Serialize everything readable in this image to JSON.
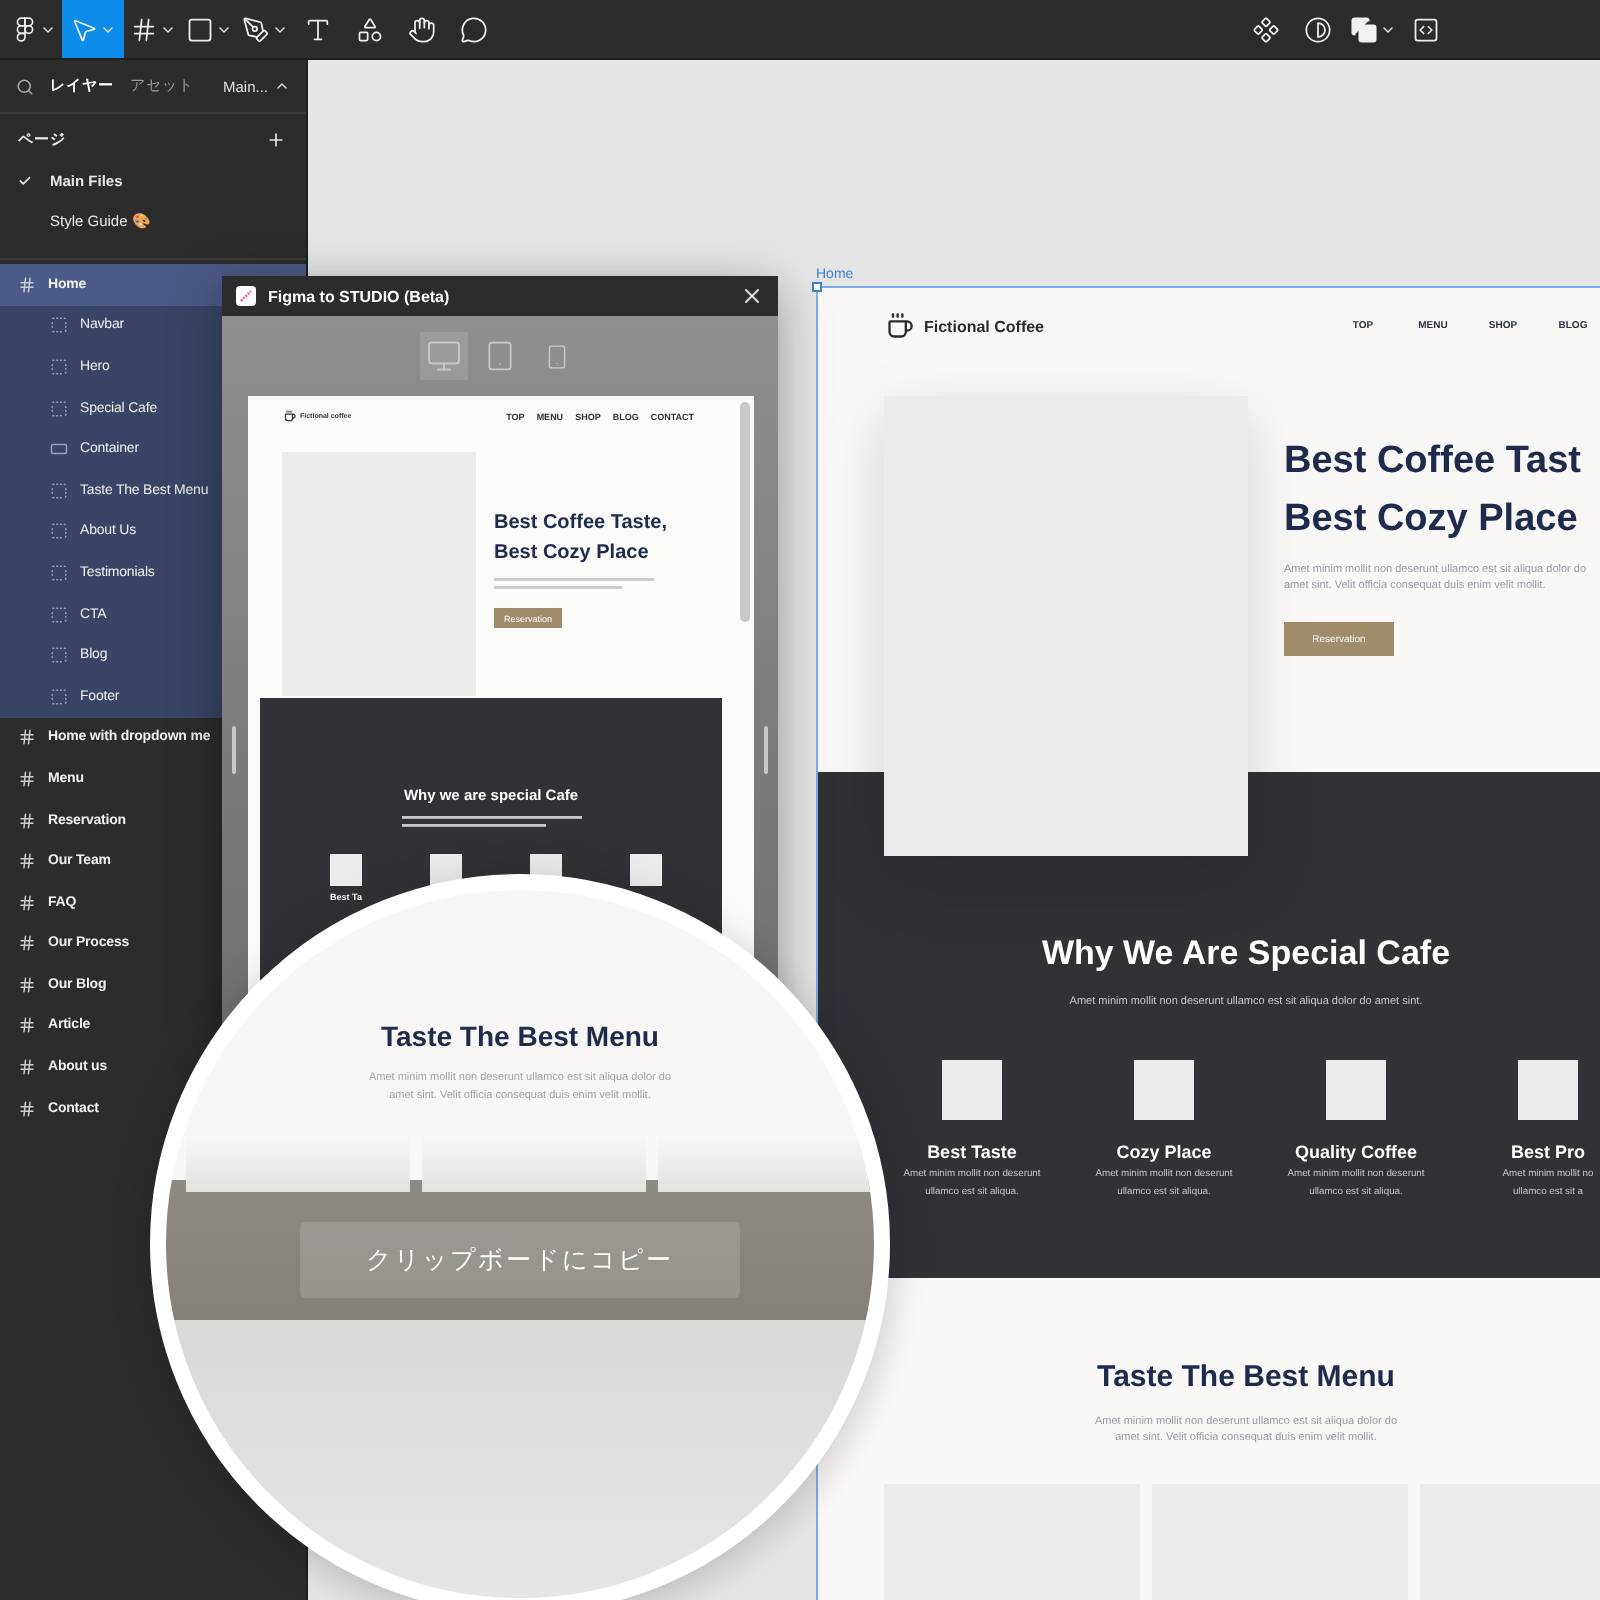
{
  "toolbar": {
    "tools": [
      {
        "kind": "main",
        "caret": true,
        "selected": false
      },
      {
        "kind": "move",
        "caret": true,
        "selected": true
      },
      {
        "kind": "frame",
        "caret": true,
        "selected": false
      },
      {
        "kind": "shape",
        "caret": true,
        "selected": false
      },
      {
        "kind": "pen",
        "caret": true,
        "selected": false
      },
      {
        "kind": "text",
        "caret": false,
        "selected": false
      },
      {
        "kind": "resources",
        "caret": false,
        "selected": false
      },
      {
        "kind": "hand",
        "caret": false,
        "selected": false
      },
      {
        "kind": "comment",
        "caret": false,
        "selected": false
      }
    ],
    "right_tools": [
      {
        "kind": "component",
        "caret": false
      },
      {
        "kind": "theme",
        "caret": false
      },
      {
        "kind": "boolean",
        "caret": true
      },
      {
        "kind": "dev",
        "caret": false
      }
    ]
  },
  "sidebar": {
    "tabs": [
      {
        "label": "レイヤー",
        "selected": true
      },
      {
        "label": "アセット",
        "selected": false
      }
    ],
    "page_menu": "Main...",
    "pages_title": "ページ",
    "pages": [
      {
        "label": "Main Files",
        "selected": true
      },
      {
        "label": "Style Guide 🎨",
        "selected": false
      }
    ],
    "layers": [
      {
        "label": "Home",
        "kind": "frame",
        "selected": true,
        "children": [
          {
            "label": "Navbar",
            "kind": "section",
            "selected": false
          },
          {
            "label": "Hero",
            "kind": "section",
            "selected": false
          },
          {
            "label": "Special Cafe",
            "kind": "section",
            "selected": false
          },
          {
            "label": "Container",
            "kind": "container",
            "selected": false
          },
          {
            "label": "Taste The Best Menu",
            "kind": "section",
            "selected": false
          },
          {
            "label": "About Us",
            "kind": "section",
            "selected": false
          },
          {
            "label": "Testimonials",
            "kind": "section",
            "selected": false
          },
          {
            "label": "CTA",
            "kind": "section",
            "selected": false
          },
          {
            "label": "Blog",
            "kind": "section",
            "selected": false
          },
          {
            "label": "Footer",
            "kind": "section",
            "selected": false
          }
        ]
      },
      {
        "label": "Home with dropdown me",
        "kind": "frame",
        "selected": false
      },
      {
        "label": "Menu",
        "kind": "frame",
        "selected": false
      },
      {
        "label": "Reservation",
        "kind": "frame",
        "selected": false
      },
      {
        "label": "Our Team",
        "kind": "frame",
        "selected": false
      },
      {
        "label": "FAQ",
        "kind": "frame",
        "selected": false
      },
      {
        "label": "Our Process",
        "kind": "frame",
        "selected": false
      },
      {
        "label": "Our Blog",
        "kind": "frame",
        "selected": false
      },
      {
        "label": "Article",
        "kind": "frame",
        "selected": false
      },
      {
        "label": "About us",
        "kind": "frame",
        "selected": false
      },
      {
        "label": "Contact",
        "kind": "frame",
        "selected": false
      }
    ]
  },
  "canvas": {
    "frame_label": "Home",
    "site": {
      "brand": "Fictional Coffee",
      "nav": [
        "TOP",
        "MENU",
        "SHOP",
        "BLOG"
      ],
      "headline": [
        "Best Coffee Tast",
        "Best Cozy Place"
      ],
      "intro": [
        "Amet minim mollit non deserunt ullamco est sit aliqua dolor do",
        "amet sint. Velit officia consequat duis enim velit mollit."
      ],
      "cta": "Reservation",
      "special_title": "Why We Are Special Cafe",
      "special_subtitle": "Amet minim mollit non deserunt ullamco est sit aliqua dolor do amet sint.",
      "features": [
        {
          "title": "Best Taste",
          "lines": [
            "Amet minim mollit non deserunt",
            "ullamco est sit aliqua."
          ]
        },
        {
          "title": "Cozy Place",
          "lines": [
            "Amet minim mollit non deserunt",
            "ullamco est sit aliqua."
          ]
        },
        {
          "title": "Quality Coffee",
          "lines": [
            "Amet minim mollit non deserunt",
            "ullamco est sit aliqua."
          ]
        },
        {
          "title": "Best Pro",
          "lines": [
            "Amet minim mollit no",
            "ullamco est sit a"
          ]
        }
      ],
      "menu_title": "Taste The Best Menu",
      "menu_intro": [
        "Amet minim mollit non deserunt ullamco est sit aliqua dolor do",
        "amet sint. Velit officia consequat duis enim velit mollit."
      ],
      "menu_cards": [
        {
          "kind": "placeholder"
        },
        {
          "kind": "placeholder"
        },
        {
          "kind": "placeholder"
        }
      ]
    }
  },
  "plugin": {
    "title": "Figma to STUDIO (Beta)",
    "devices": [
      {
        "kind": "desktop",
        "selected": true
      },
      {
        "kind": "tablet",
        "selected": false
      },
      {
        "kind": "phone",
        "selected": false
      }
    ],
    "preview": {
      "brand": "Fictional coffee",
      "nav": [
        "TOP",
        "MENU",
        "SHOP",
        "BLOG",
        "CONTACT"
      ],
      "headline": [
        "Best Coffee Taste,",
        "Best Cozy Place"
      ],
      "cta": "Reservation",
      "special_title": "Why we are special Cafe",
      "features": [
        {
          "kind": "placeholder",
          "title": "Best Ta"
        },
        {
          "kind": "placeholder"
        },
        {
          "kind": "placeholder"
        },
        {
          "kind": "placeholder"
        }
      ]
    },
    "magnifier": {
      "title": "Taste The Best Menu",
      "intro": [
        "Amet minim mollit non deserunt ullamco est sit aliqua dolor do",
        "amet sint. Velit officia consequat duis enim velit mollit."
      ],
      "copy_button": "クリップボードにコピー"
    }
  }
}
